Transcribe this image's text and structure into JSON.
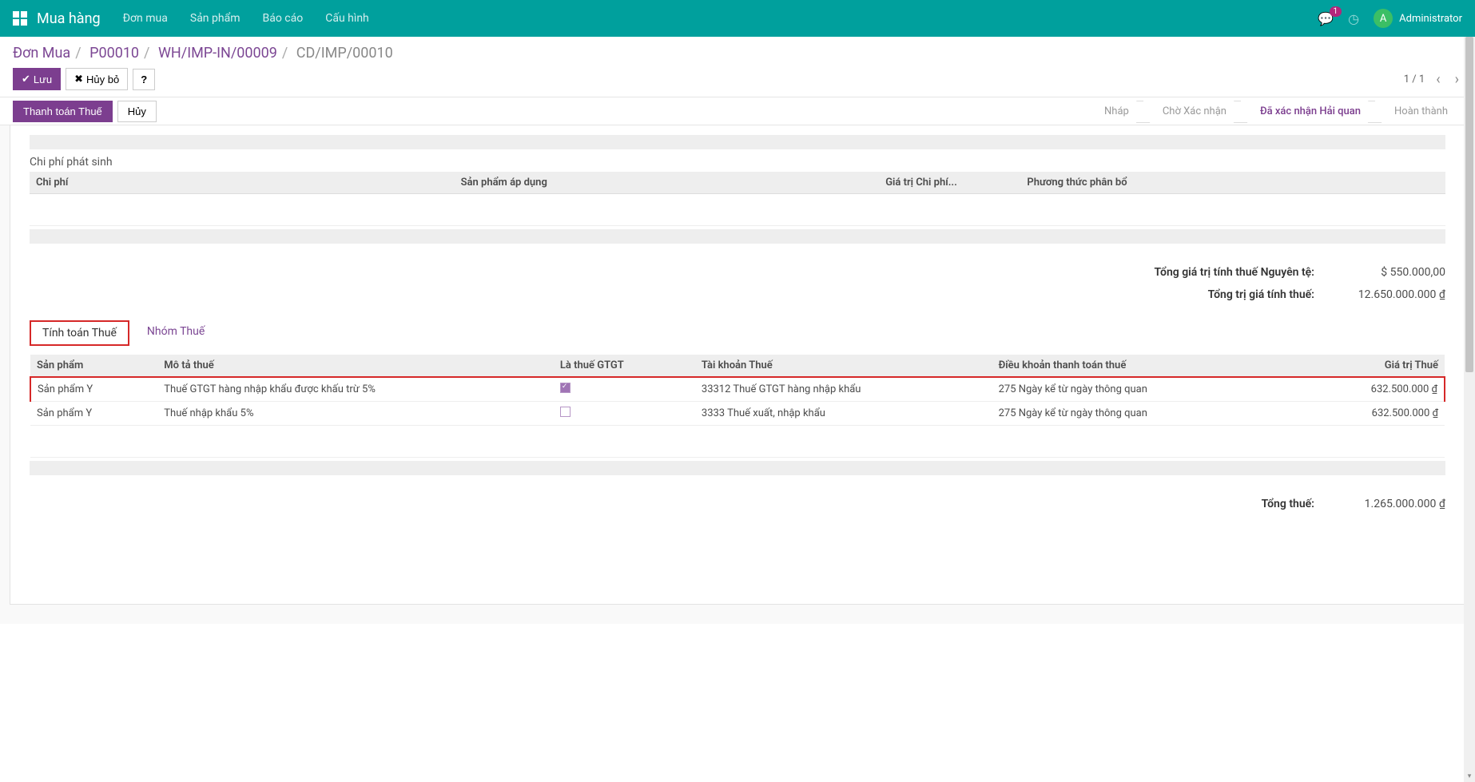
{
  "nav": {
    "brand": "Mua hàng",
    "items": [
      "Đơn mua",
      "Sản phẩm",
      "Báo cáo",
      "Cấu hình"
    ],
    "chat_badge": "1",
    "user_initial": "A",
    "user_name": "Administrator"
  },
  "breadcrumb": {
    "parts": [
      "Đơn Mua",
      "P00010",
      "WH/IMP-IN/00009"
    ],
    "current": "CD/IMP/00010"
  },
  "buttons": {
    "save": "Lưu",
    "discard": "Hủy bỏ",
    "help": "?"
  },
  "pager": {
    "text": "1 / 1"
  },
  "status": {
    "action_primary": "Thanh toán Thuế",
    "action_secondary": "Hủy",
    "steps": [
      "Nháp",
      "Chờ Xác nhận",
      "Đã xác nhận Hải quan",
      "Hoàn thành"
    ],
    "active_index": 2
  },
  "cost_section": {
    "title": "Chi phí phát sinh",
    "headers": [
      "Chi phí",
      "Sản phẩm áp dụng",
      "Giá trị Chi phí...",
      "Phương thức phân bổ"
    ]
  },
  "totals": {
    "line1_label": "Tổng giá trị tính thuế Nguyên tệ:",
    "line1_value": "$ 550.000,00",
    "line2_label": "Tổng trị giá tính thuế:",
    "line2_value": "12.650.000.000 ₫"
  },
  "tabs": {
    "tab1": "Tính toán Thuế",
    "tab2": "Nhóm Thuế"
  },
  "tax_table": {
    "headers": {
      "product": "Sản phẩm",
      "desc": "Mô tả thuế",
      "is_vat": "Là thuế GTGT",
      "account": "Tài khoản Thuế",
      "term": "Điều khoản thanh toán thuế",
      "value": "Giá trị Thuế"
    },
    "rows": [
      {
        "product": "Sản phẩm Y",
        "desc": "Thuế GTGT hàng nhập khẩu được khấu trừ 5%",
        "is_vat": true,
        "account": "33312 Thuế GTGT hàng nhập khẩu",
        "term": "275 Ngày kể từ ngày thông quan",
        "value": "632.500.000 ₫"
      },
      {
        "product": "Sản phẩm Y",
        "desc": "Thuế nhập khẩu 5%",
        "is_vat": false,
        "account": "3333 Thuế xuất, nhập khẩu",
        "term": "275 Ngày kể từ ngày thông quan",
        "value": "632.500.000 ₫"
      }
    ]
  },
  "tax_total": {
    "label": "Tổng thuế:",
    "value": "1.265.000.000 ₫"
  }
}
